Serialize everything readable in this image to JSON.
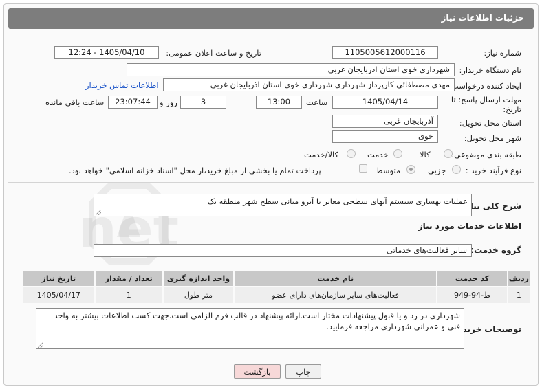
{
  "header": {
    "title": "جزئیات اطلاعات نیاز"
  },
  "fields": {
    "need_number_label": "شماره نیاز:",
    "need_number": "1105005612000116",
    "announce_label": "تاریخ و ساعت اعلان عمومی:",
    "announce_value": "1405/04/10 - 12:24",
    "buyer_org_label": "نام دستگاه خریدار:",
    "buyer_org": "شهرداری خوی استان اذربایجان غربی",
    "creator_label": "ایجاد کننده درخواست:",
    "creator": "مهدی مصطفائی کارپرداز شهرداری شهرداری خوی استان اذربایجان غربی",
    "contact_link": "اطلاعات تماس خریدار",
    "deadline_label": "مهلت ارسال پاسخ: تا تاریخ:",
    "deadline_date": "1405/04/14",
    "time_label": "ساعت",
    "deadline_time": "13:00",
    "days_value": "3",
    "days_label": "روز و",
    "remaining_time": "23:07:44",
    "remaining_label": "ساعت باقی مانده",
    "province_label": "استان محل تحویل:",
    "province": "آذربایجان غربی",
    "city_label": "شهر محل تحویل:",
    "city": "خوی",
    "category_label": "طبقه بندی موضوعی:",
    "category_options": [
      "کالا",
      "خدمت",
      "کالا/خدمت"
    ],
    "process_label": "نوع فرآیند خرید :",
    "process_options": [
      "جزیی",
      "متوسط"
    ],
    "payment_note": "پرداخت تمام یا بخشی از مبلغ خرید،از محل \"اسناد خزانه اسلامی\" خواهد بود."
  },
  "summary": {
    "label": "شرح کلی نیاز:",
    "value": "عملیات بهسازی سیستم آبهای سطحی معابر با آبرو میانی سطح شهر منطقه یک"
  },
  "services_section": {
    "title": "اطلاعات خدمات مورد نیاز",
    "group_label": "گروه خدمت:",
    "group_value": "سایر فعالیت‌های خدماتی"
  },
  "table": {
    "headers": [
      "ردیف",
      "کد خدمت",
      "نام خدمت",
      "واحد اندازه گیری",
      "تعداد / مقدار",
      "تاریخ نیاز"
    ],
    "rows": [
      [
        "1",
        "ط-94-949",
        "فعالیت‌های سایر سازمان‌های دارای عضو",
        "متر طول",
        "1",
        "1405/04/17"
      ]
    ]
  },
  "buyer_notes": {
    "label": "توضیحات خریدار:",
    "value": "شهرداری در رد و یا قبول پیشنهادات مختار است.ارائه پیشنهاد در قالب فرم الزامی است.جهت کسب اطلاعات بیشتر به واحد فنی و عمرانی شهرداری مراجعه فرمایید."
  },
  "buttons": {
    "print": "چاپ",
    "back": "بازگشت"
  },
  "watermark_text": "AriaTender.net",
  "colors": {
    "header_bg": "#7d7d7d",
    "link": "#1a53c8",
    "back_button_bg": "#f7d8d8"
  }
}
